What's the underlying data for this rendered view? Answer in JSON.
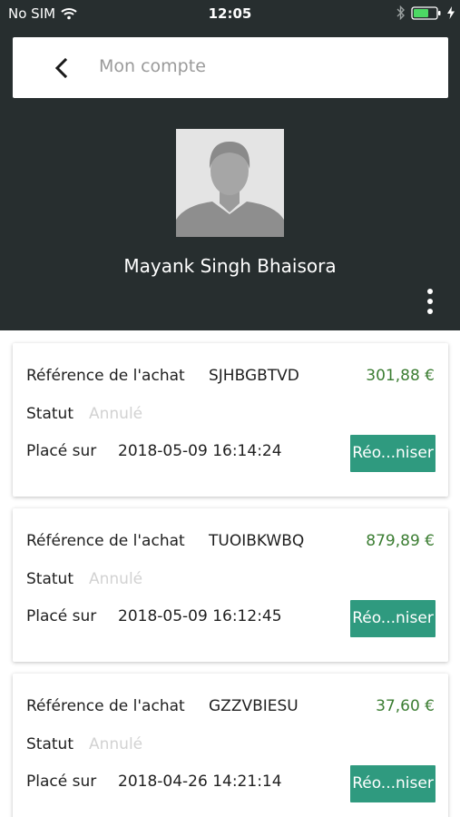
{
  "status_bar": {
    "carrier": "No SIM",
    "time": "12:05"
  },
  "header": {
    "title": "Mon compte"
  },
  "profile": {
    "name": "Mayank Singh Bhaisora"
  },
  "labels": {
    "reference": "Référence de l'achat",
    "status": "Statut",
    "placed_on": "Placé sur",
    "reorder": "Réo...niser"
  },
  "orders": [
    {
      "reference": "SJHBGBTVD",
      "amount": "301,88 €",
      "status": "Annulé",
      "date": "2018-05-09 16:14:24"
    },
    {
      "reference": "TUOIBKWBQ",
      "amount": "879,89 €",
      "status": "Annulé",
      "date": "2018-05-09 16:12:45"
    },
    {
      "reference": "GZZVBIESU",
      "amount": "37,60 €",
      "status": "Annulé",
      "date": "2018-04-26 14:21:14"
    }
  ],
  "colors": {
    "header_bg": "#272e2f",
    "accent": "#2f9a7f",
    "amount": "#3b7d32"
  },
  "icons": [
    "wifi-icon",
    "bluetooth-icon",
    "battery-icon",
    "charging-icon",
    "back-arrow-icon",
    "more-vertical-icon",
    "avatar-placeholder"
  ]
}
